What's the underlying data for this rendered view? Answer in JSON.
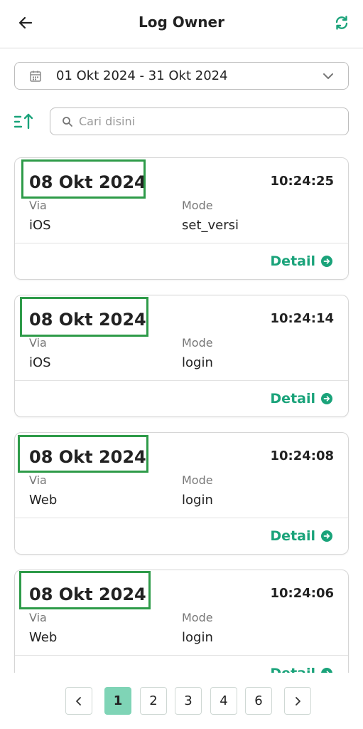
{
  "header": {
    "title": "Log Owner",
    "back_icon": "arrow-left-icon",
    "refresh_icon": "refresh-icon",
    "accent_color": "#1aa37a"
  },
  "filter": {
    "date_range": "01 Okt 2024 - 31 Okt 2024",
    "search_placeholder": "Cari disini"
  },
  "card_labels": {
    "via": "Via",
    "mode": "Mode",
    "detail": "Detail"
  },
  "logs": [
    {
      "date": "08 Okt 2024",
      "time": "10:24:25",
      "via": "iOS",
      "mode": "set_versi"
    },
    {
      "date": "08 Okt 2024",
      "time": "10:24:14",
      "via": "iOS",
      "mode": "login"
    },
    {
      "date": "08 Okt 2024",
      "time": "10:24:08",
      "via": "Web",
      "mode": "login"
    },
    {
      "date": "08 Okt 2024",
      "time": "10:24:06",
      "via": "Web",
      "mode": "login"
    }
  ],
  "pagination": {
    "pages": [
      "1",
      "2",
      "3",
      "4",
      "6"
    ],
    "current": "1"
  }
}
